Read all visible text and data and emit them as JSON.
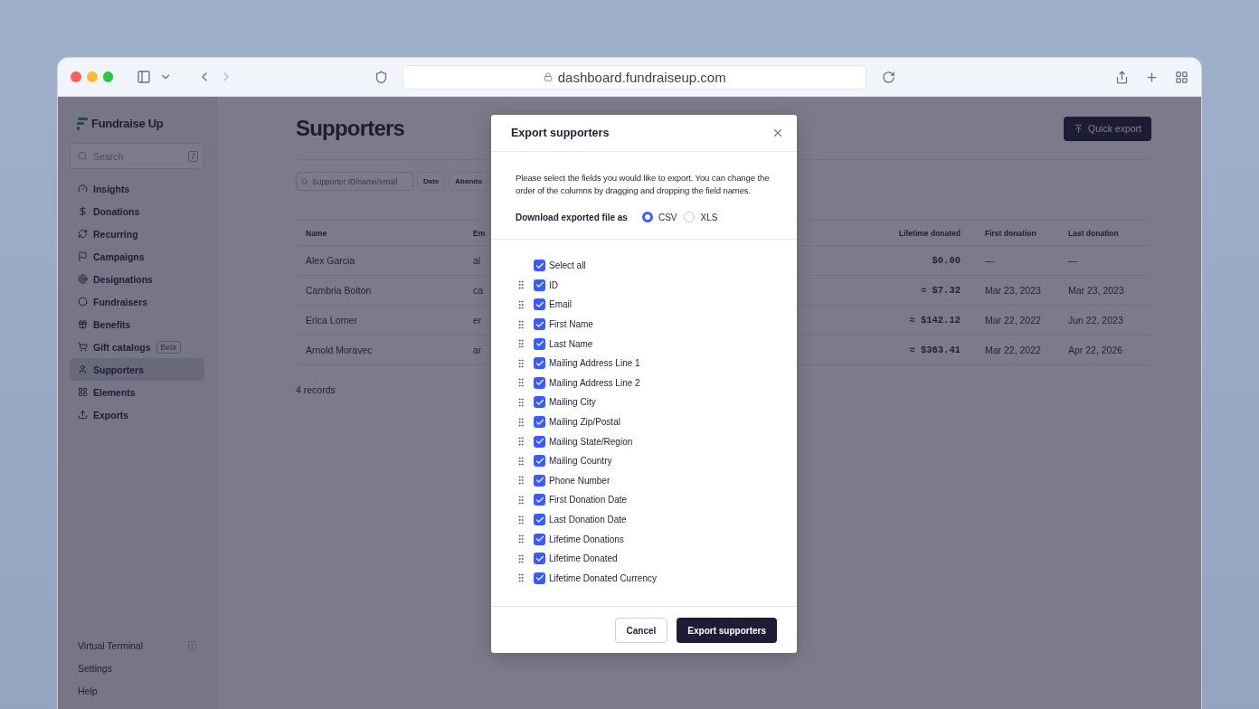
{
  "browser": {
    "url": "dashboard.fundraiseup.com"
  },
  "sidebar": {
    "logo": "Fundraise Up",
    "search": {
      "placeholder": "Search",
      "shortcut": "/"
    },
    "items": [
      {
        "label": "Insights",
        "selected": false
      },
      {
        "label": "Donations",
        "selected": false
      },
      {
        "label": "Recurring",
        "selected": false
      },
      {
        "label": "Campaigns",
        "selected": false
      },
      {
        "label": "Designations",
        "selected": false
      },
      {
        "label": "Fundraisers",
        "selected": false
      },
      {
        "label": "Benefits",
        "selected": false
      },
      {
        "label": "Gift catalogs",
        "selected": false,
        "badge": "Beta"
      },
      {
        "label": "Supporters",
        "selected": true
      },
      {
        "label": "Elements",
        "selected": false
      },
      {
        "label": "Exports",
        "selected": false
      }
    ],
    "bottom_items": [
      {
        "label": "Virtual Terminal",
        "shortcut_icon": true
      },
      {
        "label": "Settings"
      },
      {
        "label": "Help"
      }
    ]
  },
  "page": {
    "title": "Supporters",
    "quick_export": "Quick export",
    "search": {
      "placeholder": "Supporter ID/name/email"
    },
    "filters": [
      "Date",
      "Abando"
    ],
    "table": {
      "columns": [
        "Name",
        "Em",
        "Lifetime donated",
        "First donation",
        "Last donation"
      ],
      "rows": [
        [
          "Alex Garcia",
          "al",
          "$0.00",
          "—",
          "—"
        ],
        [
          "Cambria Bolton",
          "ca",
          "≈ $7.32",
          "Mar 23, 2023",
          "Mar 23, 2023"
        ],
        [
          "Erica Lorner",
          "er",
          "≈ $142.12",
          "Mar 22, 2022",
          "Jun 22, 2023"
        ],
        [
          "Arnold Moravec",
          "ar",
          "≈ $363.41",
          "Mar 22, 2022",
          "Apr 22, 2026"
        ]
      ]
    },
    "record_count": "4 records"
  },
  "dialog": {
    "title": "Export supporters",
    "description": "Please select the fields you would like to export. You can change the order of the columns by dragging and dropping the field names.",
    "format_label": "Download exported file as",
    "formats": [
      {
        "label": "CSV",
        "selected": true
      },
      {
        "label": "XLS",
        "selected": false
      }
    ],
    "select_all": {
      "label": "Select all",
      "checked": true
    },
    "fields": [
      {
        "label": "ID",
        "checked": true
      },
      {
        "label": "Email",
        "checked": true
      },
      {
        "label": "First Name",
        "checked": true
      },
      {
        "label": "Last Name",
        "checked": true
      },
      {
        "label": "Mailing Address Line 1",
        "checked": true
      },
      {
        "label": "Mailing Address Line 2",
        "checked": true
      },
      {
        "label": "Mailing City",
        "checked": true
      },
      {
        "label": "Mailing Zip/Postal",
        "checked": true
      },
      {
        "label": "Mailing State/Region",
        "checked": true
      },
      {
        "label": "Mailing Country",
        "checked": true
      },
      {
        "label": "Phone Number",
        "checked": true
      },
      {
        "label": "First Donation Date",
        "checked": true
      },
      {
        "label": "Last Donation Date",
        "checked": true
      },
      {
        "label": "Lifetime Donations",
        "checked": true
      },
      {
        "label": "Lifetime Donated",
        "checked": true
      },
      {
        "label": "Lifetime Donated Currency",
        "checked": true
      }
    ],
    "buttons": {
      "cancel": "Cancel",
      "confirm": "Export supporters"
    }
  }
}
